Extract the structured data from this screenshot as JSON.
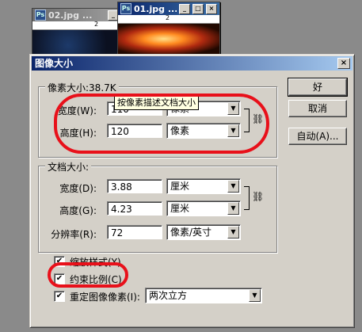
{
  "background_windows": [
    {
      "title": "02.jpg ...",
      "ruler_tick": "2"
    },
    {
      "title": "01.jpg ...",
      "ruler_tick": "2"
    }
  ],
  "window_buttons": {
    "minimize": "_",
    "maximize": "□",
    "close": "×"
  },
  "dialog": {
    "title": "图像大小",
    "close": "×"
  },
  "pixel_dimensions": {
    "legend": "像素大小:38.7K",
    "width_label": "宽度(W):",
    "width_value": "110",
    "width_unit": "像素",
    "height_label": "高度(H):",
    "height_value": "120",
    "height_unit": "像素",
    "tooltip": "按像素描述文档大小"
  },
  "document_size": {
    "legend": "文档大小:",
    "width_label": "宽度(D):",
    "width_value": "3.88",
    "width_unit": "厘米",
    "height_label": "高度(G):",
    "height_value": "4.23",
    "height_unit": "厘米",
    "resolution_label": "分辨率(R):",
    "resolution_value": "72",
    "resolution_unit": "像素/英寸"
  },
  "buttons": {
    "ok": "好",
    "cancel": "取消",
    "auto": "自动(A)..."
  },
  "options": {
    "scale_styles": {
      "label": "缩放样式(Y)",
      "checked": true
    },
    "constrain": {
      "label": "约束比例(C)",
      "checked": true
    },
    "resample": {
      "label": "重定图像像素(I):",
      "checked": true,
      "method": "两次立方"
    }
  },
  "icons": {
    "link": "chain-link-icon",
    "check": "✔"
  },
  "annotation_color": "#e8101a"
}
